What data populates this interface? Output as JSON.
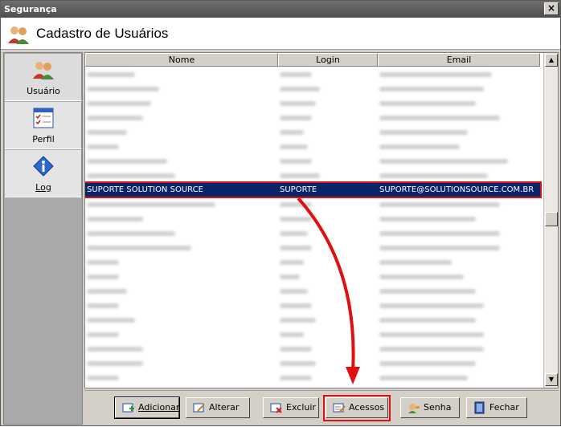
{
  "window": {
    "title": "Segurança",
    "close_label": "×"
  },
  "header": {
    "title": "Cadastro de Usuários",
    "icon": "users-icon"
  },
  "sidebar": {
    "items": [
      {
        "label": "Usuário",
        "icon": "users-icon"
      },
      {
        "label": "Perfil",
        "icon": "checklist-icon"
      },
      {
        "label": "Log",
        "icon": "info-icon"
      }
    ]
  },
  "grid": {
    "columns": [
      "Nome",
      "Login",
      "Email"
    ],
    "selected_row": {
      "nome": "SUPORTE SOLUTION SOURCE",
      "login": "SUPORTE",
      "email": "SUPORTE@SOLUTIONSOURCE.COM.BR"
    }
  },
  "scrollbar": {
    "up": "▲",
    "down": "▼"
  },
  "toolbar": {
    "adicionar": "Adicionar",
    "alterar": "Alterar",
    "excluir": "Excluir",
    "acessos": "Acessos",
    "senha": "Senha",
    "fechar": "Fechar"
  },
  "colors": {
    "selection": "#0a246a",
    "highlight": "#e01010",
    "titlebar": "#5a5a5a"
  }
}
